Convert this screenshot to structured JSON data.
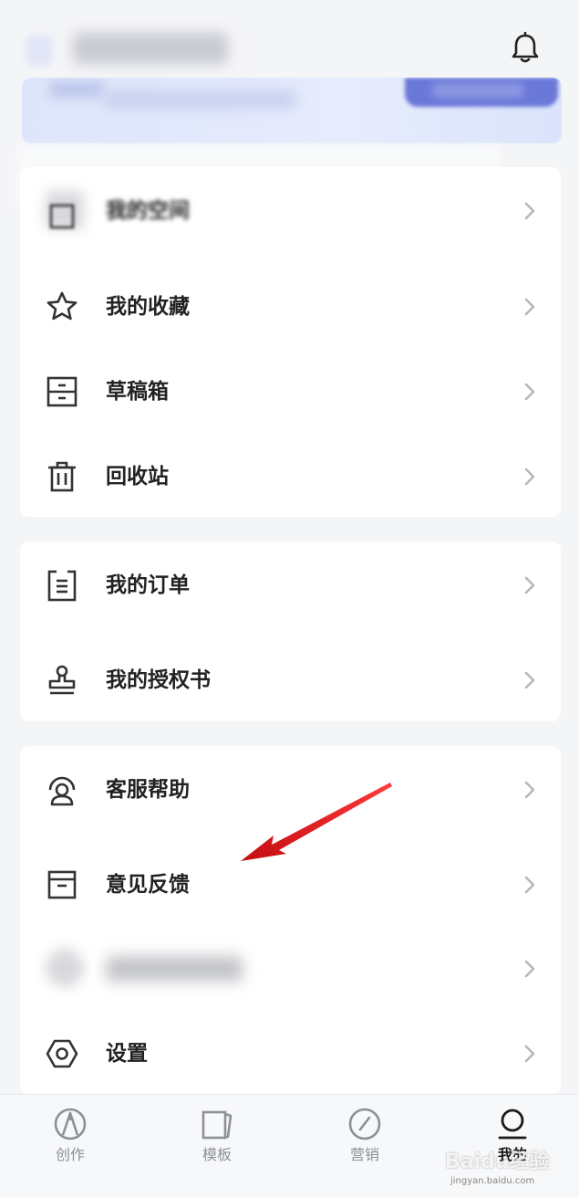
{
  "header": {
    "bell_icon": "bell-icon"
  },
  "card1": {
    "items": [
      {
        "label": "我的空间",
        "icon": "space-icon"
      },
      {
        "label": "我的收藏",
        "icon": "star-icon"
      },
      {
        "label": "草稿箱",
        "icon": "drafts-icon"
      },
      {
        "label": "回收站",
        "icon": "trash-icon"
      }
    ]
  },
  "card2": {
    "items": [
      {
        "label": "我的订单",
        "icon": "order-icon"
      },
      {
        "label": "我的授权书",
        "icon": "stamp-icon"
      }
    ]
  },
  "card3": {
    "items": [
      {
        "label": "客服帮助",
        "icon": "support-icon"
      },
      {
        "label": "意见反馈",
        "icon": "feedback-icon"
      },
      {
        "label": "设置",
        "icon": "settings-icon"
      }
    ]
  },
  "tabbar": {
    "tabs": [
      {
        "label": "创作",
        "icon": "create-icon"
      },
      {
        "label": "模板",
        "icon": "template-icon"
      },
      {
        "label": "营销",
        "icon": "marketing-icon"
      },
      {
        "label": "我的",
        "icon": "profile-icon",
        "active": true
      }
    ]
  },
  "watermark": {
    "main": "Baidu经验",
    "sub": "jingyan.baidu.com"
  },
  "colors": {
    "background": "#f4f5f7",
    "card": "#ffffff",
    "text": "#222222",
    "chevron": "#b5b7bc",
    "annotation_arrow": "#e0141b",
    "banner": "#dfe6fb",
    "banner_button": "#6a78d8"
  }
}
